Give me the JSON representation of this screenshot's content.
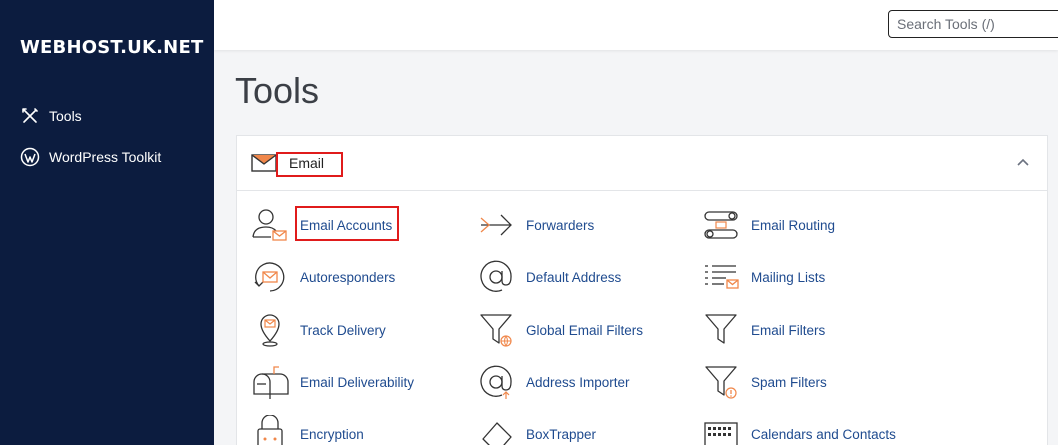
{
  "brand": {
    "name": "WEBHOST.UK.NET"
  },
  "sidebar": {
    "items": [
      {
        "label": "Tools",
        "icon": "tools-icon"
      },
      {
        "label": "WordPress Toolkit",
        "icon": "wordpress-icon"
      }
    ]
  },
  "search": {
    "placeholder": "Search Tools (/)"
  },
  "page": {
    "title": "Tools"
  },
  "section": {
    "title": "Email",
    "icon": "envelope-icon",
    "collapse_icon": "chevron-up-icon"
  },
  "tools": [
    {
      "label": "Email Accounts",
      "icon": "email-accounts-icon"
    },
    {
      "label": "Forwarders",
      "icon": "forwarders-icon"
    },
    {
      "label": "Email Routing",
      "icon": "email-routing-icon"
    },
    {
      "label": "Autoresponders",
      "icon": "autoresponders-icon"
    },
    {
      "label": "Default Address",
      "icon": "at-sign-icon"
    },
    {
      "label": "Mailing Lists",
      "icon": "mailing-lists-icon"
    },
    {
      "label": "Track Delivery",
      "icon": "track-delivery-icon"
    },
    {
      "label": "Global Email Filters",
      "icon": "global-filter-icon"
    },
    {
      "label": "Email Filters",
      "icon": "filter-icon"
    },
    {
      "label": "Email Deliverability",
      "icon": "mailbox-icon"
    },
    {
      "label": "Address Importer",
      "icon": "address-importer-icon"
    },
    {
      "label": "Spam Filters",
      "icon": "spam-filter-icon"
    },
    {
      "label": "Encryption",
      "icon": "encryption-icon"
    },
    {
      "label": "BoxTrapper",
      "icon": "boxtrapper-icon"
    },
    {
      "label": "Calendars and Contacts",
      "icon": "calendar-icon"
    }
  ],
  "colors": {
    "sidebar": "#0c1c3f",
    "link": "#1f4b8f",
    "accent": "#f0874a",
    "highlight": "#e01b1b"
  }
}
